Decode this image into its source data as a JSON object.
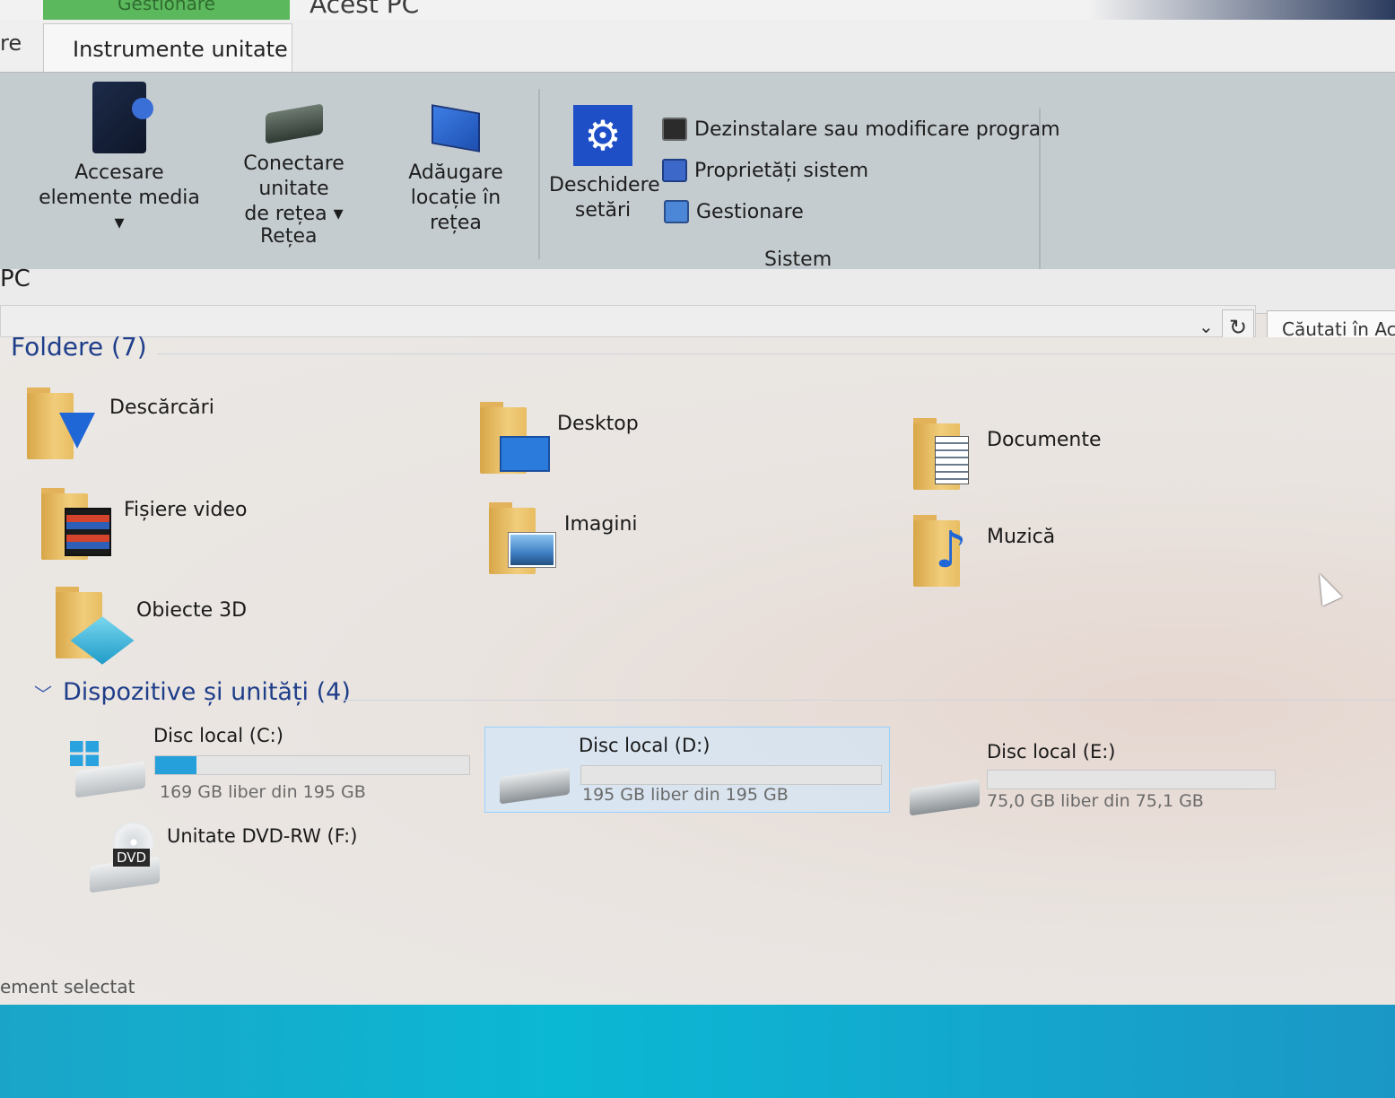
{
  "window": {
    "context_tab": "Gestionare",
    "title": "Acest PC"
  },
  "tabs": {
    "left_fragment": "re",
    "active": "Instrumente unitate"
  },
  "ribbon": {
    "buttons": [
      {
        "label1": "Accesare",
        "label2": "elemente media ▾",
        "icon": "media-server-icon"
      },
      {
        "label1": "Conectare unitate",
        "label2": "de rețea ▾",
        "icon": "network-drive-icon"
      },
      {
        "label1": "Adăugare",
        "label2": "locație în rețea",
        "icon": "network-location-icon"
      },
      {
        "label1": "Deschidere",
        "label2": "setări",
        "icon": "settings-gear-icon"
      }
    ],
    "group_retea": "Rețea",
    "system_items": [
      {
        "label": "Dezinstalare sau modificare program",
        "icon": "uninstall-icon"
      },
      {
        "label": "Proprietăți sistem",
        "icon": "system-properties-icon"
      },
      {
        "label": "Gestionare",
        "icon": "computer-management-icon"
      }
    ],
    "group_sistem": "Sistem"
  },
  "address": {
    "location": "PC",
    "refresh_glyph": "↻",
    "dropdown_glyph": "⌄",
    "search_placeholder": "Căutați în Ac"
  },
  "folders": {
    "heading": "Foldere (7)",
    "items": [
      {
        "label": "Descărcări",
        "overlay": "download-arrow"
      },
      {
        "label": "Desktop",
        "overlay": "desktop-screen"
      },
      {
        "label": "Documente",
        "overlay": "document-page"
      },
      {
        "label": "Fișiere video",
        "overlay": "film-strip"
      },
      {
        "label": "Imagini",
        "overlay": "landscape-picture"
      },
      {
        "label": "Muzică",
        "overlay": "music-note"
      },
      {
        "label": "Obiecte 3D",
        "overlay": "3d-cube"
      }
    ]
  },
  "devices": {
    "heading": "Dispozitive și unități (4)",
    "drives": [
      {
        "label": "Disc local (C:)",
        "free": "169 GB liber din 195 GB",
        "used_fraction": 0.13,
        "selected": false
      },
      {
        "label": "Disc local (D:)",
        "free": "195 GB liber din 195 GB",
        "used_fraction": 0.0,
        "selected": true
      },
      {
        "label": "Disc local (E:)",
        "free": "75,0 GB liber din 75,1 GB",
        "used_fraction": 0.0,
        "selected": false
      }
    ],
    "dvd": {
      "label": "Unitate DVD-RW (F:)",
      "badge": "DVD"
    }
  },
  "status": {
    "text": "ement selectat"
  },
  "colors": {
    "accent": "#26a0da",
    "heading": "#1f3e8a",
    "context_tab": "#5cb85c",
    "taskbar": "#0bb8d4"
  }
}
